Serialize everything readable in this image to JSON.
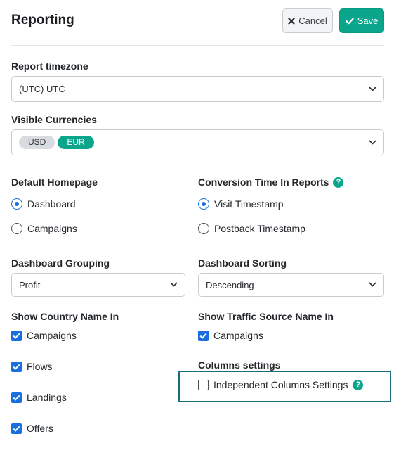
{
  "header": {
    "title": "Reporting",
    "cancel_label": "Cancel",
    "save_label": "Save"
  },
  "colors": {
    "accent": "#0aa58b",
    "control_blue": "#1a6fe0",
    "focus_outline": "#186e80"
  },
  "timezone": {
    "label": "Report timezone",
    "value": "(UTC) UTC"
  },
  "currencies": {
    "label": "Visible Currencies",
    "tags": [
      "USD",
      "EUR"
    ]
  },
  "default_homepage": {
    "label": "Default Homepage",
    "options": [
      {
        "label": "Dashboard",
        "checked": true
      },
      {
        "label": "Campaigns",
        "checked": false
      }
    ]
  },
  "conversion_time": {
    "label": "Conversion Time In Reports",
    "help_icon": "question-circle-icon",
    "options": [
      {
        "label": "Visit Timestamp",
        "checked": true
      },
      {
        "label": "Postback Timestamp",
        "checked": false
      }
    ]
  },
  "dashboard_grouping": {
    "label": "Dashboard Grouping",
    "value": "Profit"
  },
  "dashboard_sorting": {
    "label": "Dashboard Sorting",
    "value": "Descending"
  },
  "country_name": {
    "label": "Show Country Name In",
    "items": [
      {
        "label": "Campaigns",
        "checked": true
      },
      {
        "label": "Flows",
        "checked": true
      },
      {
        "label": "Landings",
        "checked": true
      },
      {
        "label": "Offers",
        "checked": true
      }
    ]
  },
  "traffic_source_name": {
    "label": "Show Traffic Source Name In",
    "items": [
      {
        "label": "Campaigns",
        "checked": true
      }
    ]
  },
  "columns_settings": {
    "label": "Columns settings",
    "independent_label": "Independent Columns Settings",
    "independent_checked": false,
    "help_icon": "question-circle-icon"
  }
}
